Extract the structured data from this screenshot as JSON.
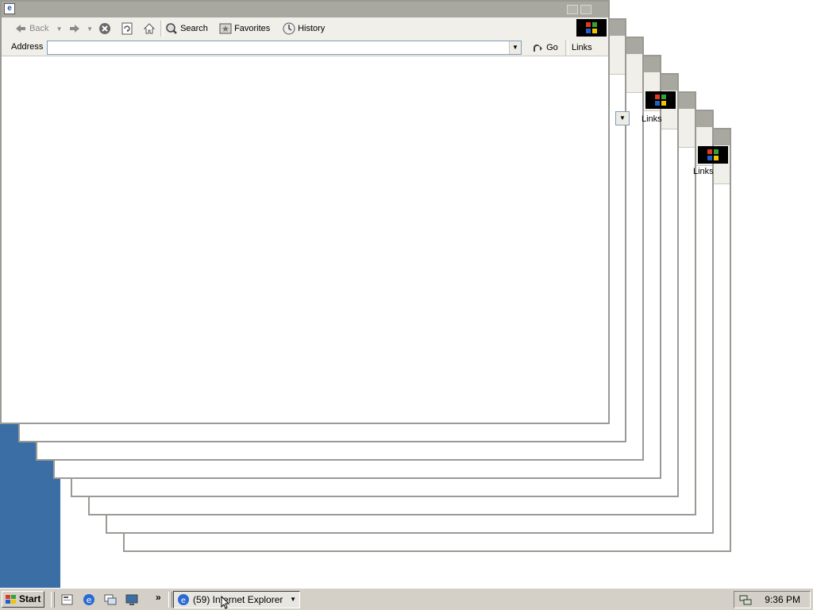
{
  "toolbar": {
    "back_label": "Back",
    "search_label": "Search",
    "favorites_label": "Favorites",
    "history_label": "History"
  },
  "address_bar": {
    "label": "Address",
    "value": "",
    "go_label": "Go",
    "links_label": "Links"
  },
  "ghost_windows": {
    "links_label": "Links"
  },
  "taskbar": {
    "start_label": "Start",
    "task_label": "(59) Internet Explorer",
    "clock": "9:36 PM"
  },
  "colors": {
    "desktop_blue": "#3a6ea5",
    "title_gray": "#a8a8a0",
    "toolbar_bg": "#f0efe9",
    "taskbar_bg": "#d4d0c8"
  }
}
